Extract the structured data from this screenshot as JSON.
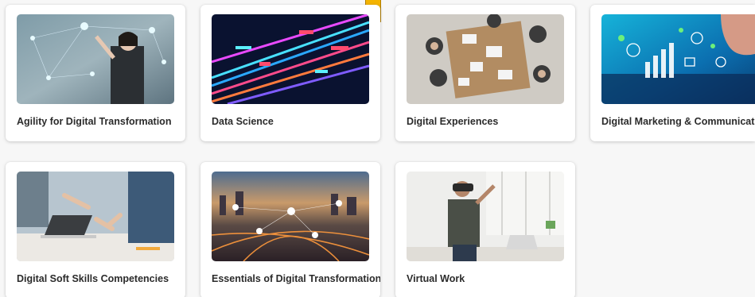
{
  "courses": [
    {
      "title": "Agility for Digital Transformation",
      "image": "woman-touching-network-hologram"
    },
    {
      "title": "Data Science",
      "image": "colorful-data-streams"
    },
    {
      "title": "Digital Experiences",
      "image": "team-meeting-overhead"
    },
    {
      "title": "Digital Marketing & Communications",
      "image": "finger-tapping-tablet-icons"
    },
    {
      "title": "Digital Soft Skills Competencies",
      "image": "hands-at-laptop-meeting"
    },
    {
      "title": "Essentials of Digital Transformation",
      "image": "connected-city-at-dusk"
    },
    {
      "title": "Virtual Work",
      "image": "woman-in-vr-headset"
    }
  ],
  "colors": {
    "card_bg": "#ffffff",
    "page_bg": "#f7f7f7",
    "label_text": "#2b2b2b",
    "bookmark": "#f4b400"
  }
}
